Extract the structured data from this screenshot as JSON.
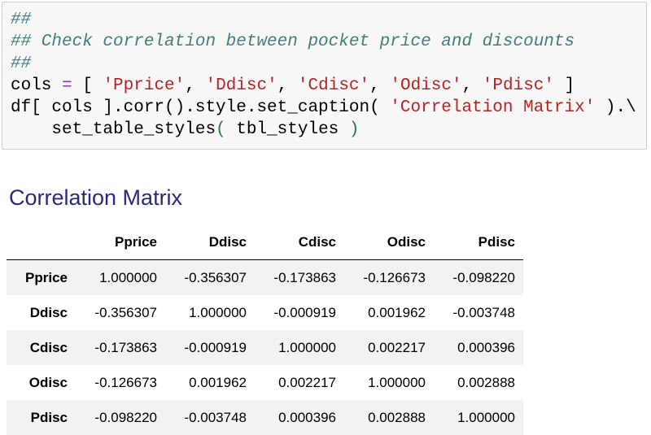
{
  "code_cell": {
    "line1": "##",
    "line2": "## Check correlation between pocket price and discounts",
    "line3": "##",
    "line4_a": "cols ",
    "line4_op": "=",
    "line4_b": " [ ",
    "s1": "'Pprice'",
    "s2": "'Ddisc'",
    "s3": "'Cdisc'",
    "s4": "'Odisc'",
    "s5": "'Pdisc'",
    "comma": ", ",
    "line4_end": " ]",
    "line5_a": "df[ cols ].corr().style.set_caption( ",
    "s6": "'Correlation Matrix'",
    "line5_b": " ).\\",
    "line6_a": "    set_table_styles",
    "paren_open": "(",
    "line6_b": " tbl_styles ",
    "paren_close": ")"
  },
  "caption": "Correlation Matrix",
  "table": {
    "corner": "",
    "columns": [
      "Pprice",
      "Ddisc",
      "Cdisc",
      "Odisc",
      "Pdisc"
    ],
    "rows": [
      {
        "label": "Pprice",
        "values": [
          "1.000000",
          "-0.356307",
          "-0.173863",
          "-0.126673",
          "-0.098220"
        ]
      },
      {
        "label": "Ddisc",
        "values": [
          "-0.356307",
          "1.000000",
          "-0.000919",
          "0.001962",
          "-0.003748"
        ]
      },
      {
        "label": "Cdisc",
        "values": [
          "-0.173863",
          "-0.000919",
          "1.000000",
          "0.002217",
          "0.000396"
        ]
      },
      {
        "label": "Odisc",
        "values": [
          "-0.126673",
          "0.001962",
          "0.002217",
          "1.000000",
          "0.002888"
        ]
      },
      {
        "label": "Pdisc",
        "values": [
          "-0.098220",
          "-0.003748",
          "0.000396",
          "0.002888",
          "1.000000"
        ]
      }
    ]
  }
}
